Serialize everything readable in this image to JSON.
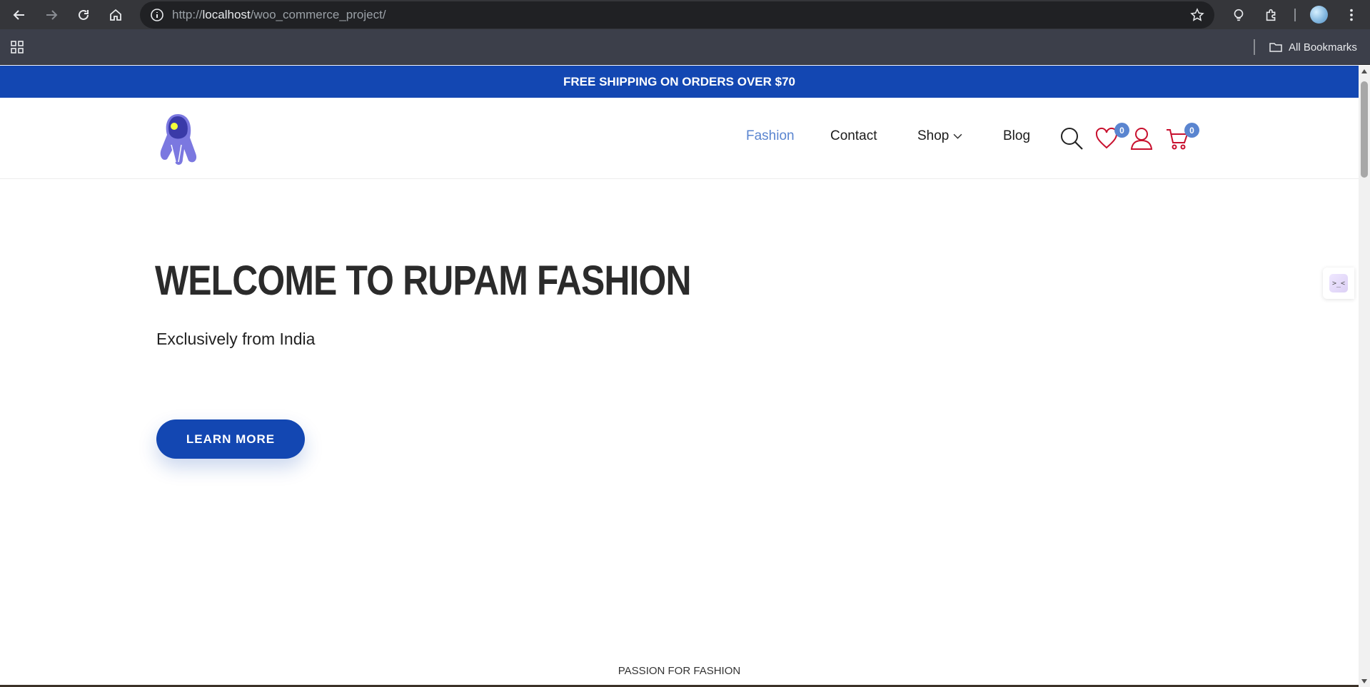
{
  "browser": {
    "url_prefix": "http://",
    "url_host": "localhost",
    "url_path": "/woo_commerce_project/",
    "bookmarks_label": "All Bookmarks"
  },
  "site": {
    "shipping_banner": "FREE SHIPPING ON ORDERS OVER $70",
    "nav": {
      "fashion": "Fashion",
      "contact": "Contact",
      "shop": "Shop",
      "blog": "Blog"
    },
    "wishlist_count": "0",
    "cart_count": "0",
    "hero": {
      "title": "WELCOME TO RUPAM FASHION",
      "subtitle": "Exclusively from India",
      "button": "LEARN MORE"
    },
    "section_label": "PASSION FOR FASHION",
    "side_widget": ">_<"
  },
  "colors": {
    "brand_blue": "#1347b2",
    "active_link": "#5a85d0",
    "icon_red": "#c8102e"
  }
}
